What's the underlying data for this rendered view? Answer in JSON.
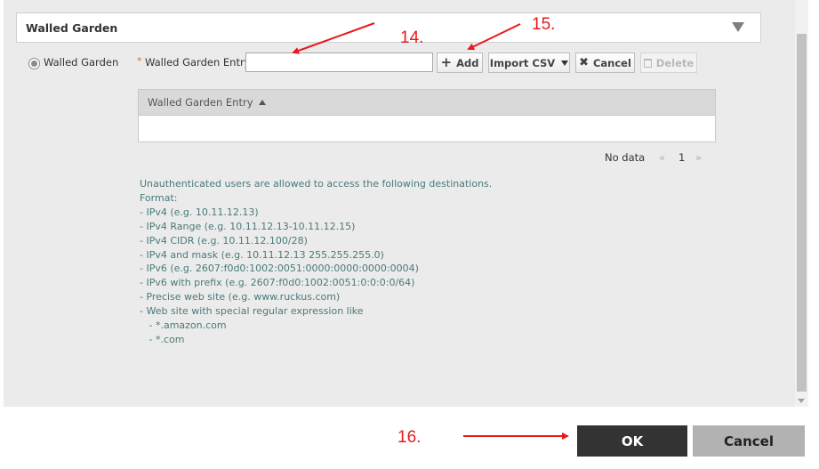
{
  "section": {
    "title": "Walled Garden"
  },
  "form": {
    "radio_label": "Walled Garden",
    "required_mark": "*",
    "field_label": "Walled Garden Entry",
    "entry_value": "",
    "add_label": "Add",
    "import_label": "Import CSV",
    "cancel_label": "Cancel",
    "delete_label": "Delete"
  },
  "table": {
    "columns": [
      "Walled Garden Entry"
    ],
    "rows": []
  },
  "pagination": {
    "status": "No data",
    "prev": "«",
    "page": "1",
    "next": "»"
  },
  "info": {
    "lines": [
      "Unauthenticated users are allowed to access the following destinations.",
      "Format:",
      "- IPv4 (e.g. 10.11.12.13)",
      "- IPv4 Range (e.g. 10.11.12.13-10.11.12.15)",
      "- IPv4 CIDR (e.g. 10.11.12.100/28)",
      "- IPv4 and mask (e.g. 10.11.12.13 255.255.255.0)",
      "- IPv6 (e.g. 2607:f0d0:1002:0051:0000:0000:0000:0004)",
      "- IPv6 with prefix (e.g. 2607:f0d0:1002:0051:0:0:0:0/64)",
      "- Precise web site (e.g. www.ruckus.com)",
      "- Web site with special regular expression like",
      "   - *.amazon.com",
      "   - *.com"
    ]
  },
  "annotations": {
    "step14": "14.",
    "step15": "15.",
    "step16": "16."
  },
  "footer": {
    "ok_label": "OK",
    "cancel_label": "Cancel"
  },
  "colors": {
    "annotation": "#e8191b",
    "ok_bg": "#333333",
    "cancel_bg": "#b2b2b2",
    "info_text": "#4a7a7a",
    "required": "#e0672b"
  },
  "icons": [
    "caret-down-icon",
    "radio-icon",
    "plus-icon",
    "dropdown-icon",
    "close-icon",
    "trash-icon",
    "sort-asc-icon"
  ]
}
